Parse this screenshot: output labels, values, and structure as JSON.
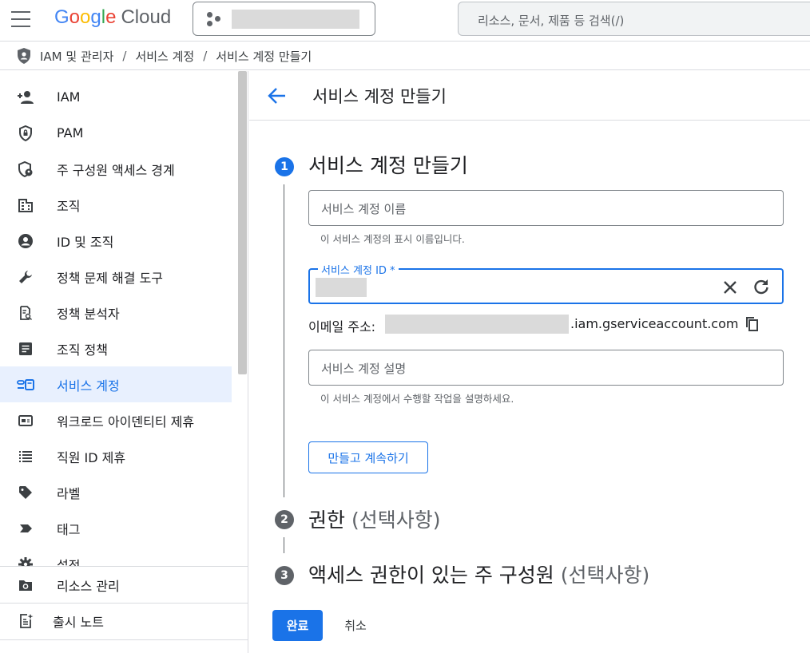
{
  "topbar": {
    "menu_icon": "hamburger-menu-icon",
    "logo": {
      "google": "Google",
      "cloud": "Cloud"
    },
    "project_picker_icon": "project-dots-icon",
    "search_placeholder": "리소스, 문서, 제품 등 검색(/)"
  },
  "breadcrumb": {
    "icon": "iam-shield-icon",
    "items": [
      "IAM 및 관리자",
      "서비스 계정",
      "서비스 계정 만들기"
    ],
    "separator": "/"
  },
  "sidebar": {
    "items": [
      {
        "label": "IAM",
        "icon": "person-add-icon"
      },
      {
        "label": "PAM",
        "icon": "shield-lock-icon"
      },
      {
        "label": "주 구성원 액세스 경계",
        "icon": "shield-person-icon"
      },
      {
        "label": "조직",
        "icon": "building-icon"
      },
      {
        "label": "ID 및 조직",
        "icon": "account-circle-icon"
      },
      {
        "label": "정책 문제 해결 도구",
        "icon": "wrench-icon"
      },
      {
        "label": "정책 분석자",
        "icon": "policy-search-icon"
      },
      {
        "label": "조직 정책",
        "icon": "document-list-icon"
      },
      {
        "label": "서비스 계정",
        "icon": "service-account-icon",
        "active": true
      },
      {
        "label": "워크로드 아이덴티티 제휴",
        "icon": "id-card-icon"
      },
      {
        "label": "직원 ID 제휴",
        "icon": "list-icon"
      },
      {
        "label": "라벨",
        "icon": "label-tag-icon"
      },
      {
        "label": "태그",
        "icon": "chevron-tag-icon"
      },
      {
        "label": "설정",
        "icon": "gear-icon"
      }
    ],
    "bottom_items": [
      {
        "label": "리소스 관리",
        "icon": "folder-gear-icon"
      },
      {
        "label": "출시 노트",
        "icon": "release-notes-icon"
      }
    ]
  },
  "main": {
    "back_icon": "back-arrow-icon",
    "title": "서비스 계정 만들기",
    "steps": [
      {
        "number": "1",
        "title": "서비스 계정 만들기",
        "optional": ""
      },
      {
        "number": "2",
        "title": "권한",
        "optional": "(선택사항)"
      },
      {
        "number": "3",
        "title": "액세스 권한이 있는 주 구성원",
        "optional": "(선택사항)"
      }
    ],
    "form": {
      "name_placeholder": "서비스 계정 이름",
      "name_hint": "이 서비스 계정의 표시 이름입니다.",
      "id_label": "서비스 계정 ID *",
      "id_clear_icon": "close-icon",
      "id_refresh_icon": "refresh-icon",
      "email_label": "이메일 주소:",
      "email_domain": ".iam.gserviceaccount.com",
      "copy_icon": "copy-icon",
      "description_placeholder": "서비스 계정 설명",
      "description_hint": "이 서비스 계정에서 수행할 작업을 설명하세요.",
      "create_continue_label": "만들고 계속하기"
    },
    "done_label": "완료",
    "cancel_label": "취소"
  },
  "colors": {
    "accent": "#1a73e8",
    "active_bg": "#e8f0fe",
    "text": "#202124",
    "muted": "#5f6368"
  }
}
